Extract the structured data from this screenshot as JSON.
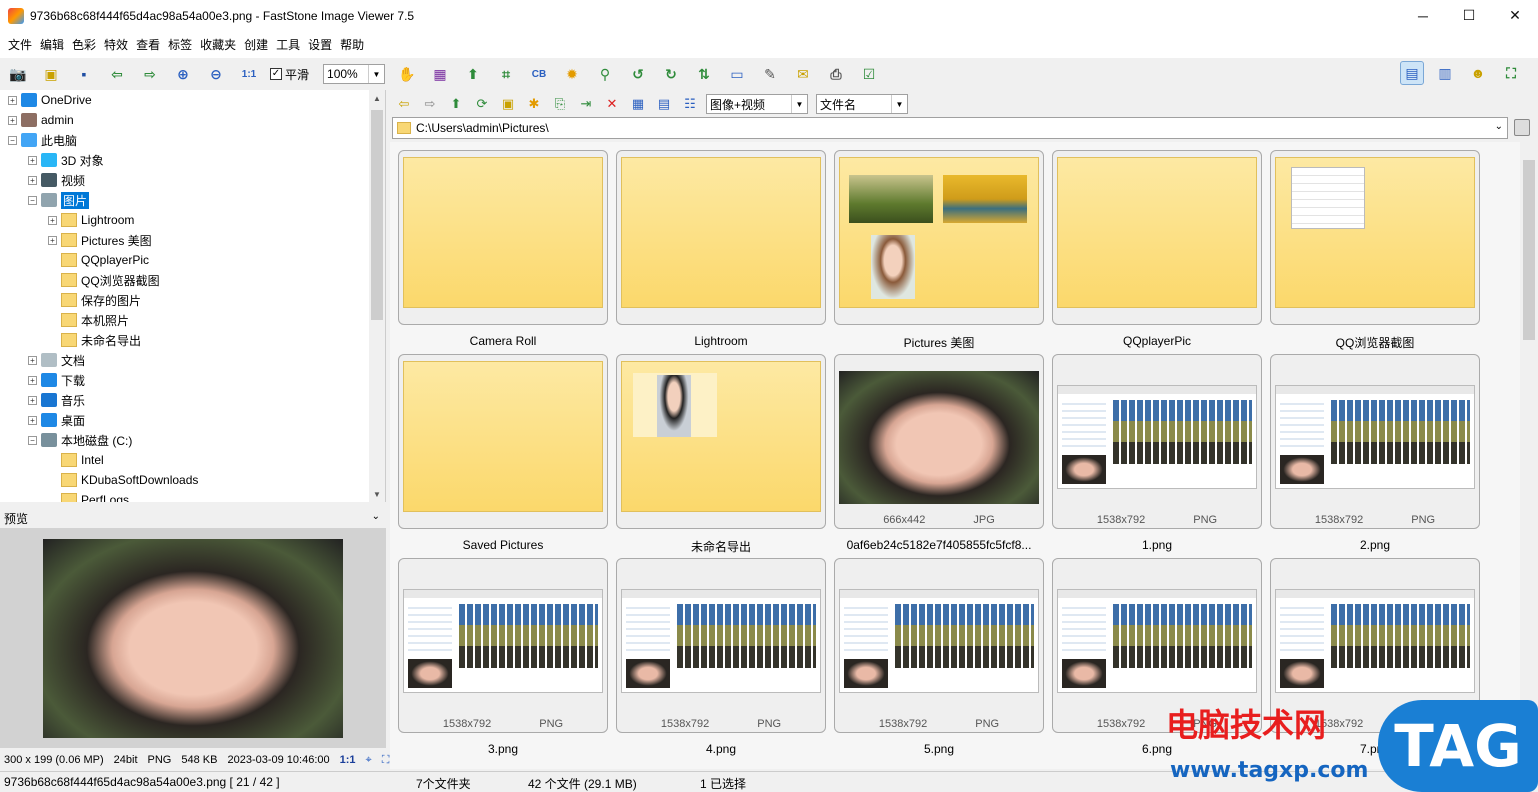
{
  "window": {
    "title": "9736b68c68f444f65d4ac98a54a00e3.png  -  FastStone Image Viewer 7.5",
    "controls": [
      "─",
      "☐",
      "✕"
    ]
  },
  "menu": [
    "文件",
    "编辑",
    "色彩",
    "特效",
    "查看",
    "标签",
    "收藏夹",
    "创建",
    "工具",
    "设置",
    "帮助"
  ],
  "toolbar": {
    "smooth_label": "平滑",
    "smooth_checked": "✓",
    "zoom_value": "100%"
  },
  "tree": [
    {
      "label": "OneDrive",
      "icon": "cloud-icon",
      "level": 0,
      "expander": "+"
    },
    {
      "label": "admin",
      "icon": "user-icon",
      "level": 0,
      "expander": "+"
    },
    {
      "label": "此电脑",
      "icon": "computer-icon",
      "level": 0,
      "expander": "−"
    },
    {
      "label": "3D 对象",
      "icon": "cube-icon",
      "level": 1,
      "expander": "+"
    },
    {
      "label": "视频",
      "icon": "film-icon",
      "level": 1,
      "expander": "+"
    },
    {
      "label": "图片",
      "icon": "pictures-icon",
      "level": 1,
      "expander": "−",
      "selected": true
    },
    {
      "label": "Lightroom",
      "icon": "folder-icon",
      "level": 2,
      "expander": "+"
    },
    {
      "label": "Pictures 美图",
      "icon": "folder-icon",
      "level": 2,
      "expander": "+"
    },
    {
      "label": "QQplayerPic",
      "icon": "folder-icon",
      "level": 2,
      "expander": ""
    },
    {
      "label": "QQ浏览器截图",
      "icon": "folder-icon",
      "level": 2,
      "expander": ""
    },
    {
      "label": "保存的图片",
      "icon": "folder-icon",
      "level": 2,
      "expander": ""
    },
    {
      "label": "本机照片",
      "icon": "folder-icon",
      "level": 2,
      "expander": ""
    },
    {
      "label": "未命名导出",
      "icon": "folder-icon",
      "level": 2,
      "expander": ""
    },
    {
      "label": "文档",
      "icon": "document-icon",
      "level": 1,
      "expander": "+"
    },
    {
      "label": "下载",
      "icon": "download-icon",
      "level": 1,
      "expander": "+"
    },
    {
      "label": "音乐",
      "icon": "music-icon",
      "level": 1,
      "expander": "+"
    },
    {
      "label": "桌面",
      "icon": "desktop-icon",
      "level": 1,
      "expander": "+"
    },
    {
      "label": "本地磁盘 (C:)",
      "icon": "drive-icon",
      "level": 1,
      "expander": "−"
    },
    {
      "label": "Intel",
      "icon": "folder-icon",
      "level": 2,
      "expander": ""
    },
    {
      "label": "KDubaSoftDownloads",
      "icon": "folder-icon",
      "level": 2,
      "expander": ""
    },
    {
      "label": "PerfLogs",
      "icon": "folder-icon",
      "level": 2,
      "expander": ""
    }
  ],
  "preview": {
    "heading": "预览",
    "info": [
      "300 x 199 (0.06 MP)",
      "24bit",
      "PNG",
      "548 KB",
      "2023-03-09 10:46:00",
      "1:1"
    ]
  },
  "nav": {
    "filter_value": "图像+视频",
    "sort_value": "文件名",
    "path": "C:\\Users\\admin\\Pictures\\"
  },
  "thumbnails": [
    {
      "name": "Camera Roll",
      "kind": "folder",
      "size": "",
      "fmt": ""
    },
    {
      "name": "Lightroom",
      "kind": "folder",
      "size": "",
      "fmt": ""
    },
    {
      "name": "Pictures 美图",
      "kind": "folder-photos",
      "size": "",
      "fmt": ""
    },
    {
      "name": "QQplayerPic",
      "kind": "folder",
      "size": "",
      "fmt": ""
    },
    {
      "name": "QQ浏览器截图",
      "kind": "folder-doc",
      "size": "",
      "fmt": ""
    },
    {
      "name": "Saved Pictures",
      "kind": "folder",
      "size": "",
      "fmt": ""
    },
    {
      "name": "未命名导出",
      "kind": "folder-person",
      "size": "",
      "fmt": ""
    },
    {
      "name": "0af6eb24c5182e7f405855fc5fcf8...",
      "kind": "photo",
      "size": "666x442",
      "fmt": "JPG"
    },
    {
      "name": "1.png",
      "kind": "screenshot",
      "size": "1538x792",
      "fmt": "PNG"
    },
    {
      "name": "2.png",
      "kind": "screenshot",
      "size": "1538x792",
      "fmt": "PNG"
    },
    {
      "name": "3.png",
      "kind": "screenshot",
      "size": "1538x792",
      "fmt": "PNG"
    },
    {
      "name": "4.png",
      "kind": "screenshot",
      "size": "1538x792",
      "fmt": "PNG"
    },
    {
      "name": "5.png",
      "kind": "screenshot",
      "size": "1538x792",
      "fmt": "PNG"
    },
    {
      "name": "6.png",
      "kind": "screenshot",
      "size": "1538x792",
      "fmt": "PNG"
    },
    {
      "name": "7.png",
      "kind": "screenshot",
      "size": "1538x792",
      "fmt": "PNG"
    }
  ],
  "status": {
    "file": "9736b68c68f444f65d4ac98a54a00e3.png [ 21 / 42 ]",
    "folders": "7个文件夹",
    "files": "42 个文件 (29.1 MB)",
    "selected": "1 已选择"
  },
  "watermark": {
    "cn": "电脑技术网",
    "url": "www.tagxp.com",
    "tag": "TAG"
  },
  "colors": {
    "selection": "#0078d7",
    "folder": "#fbd86b",
    "watermark_red": "#e81e1e",
    "watermark_blue": "#1a7fd4"
  }
}
